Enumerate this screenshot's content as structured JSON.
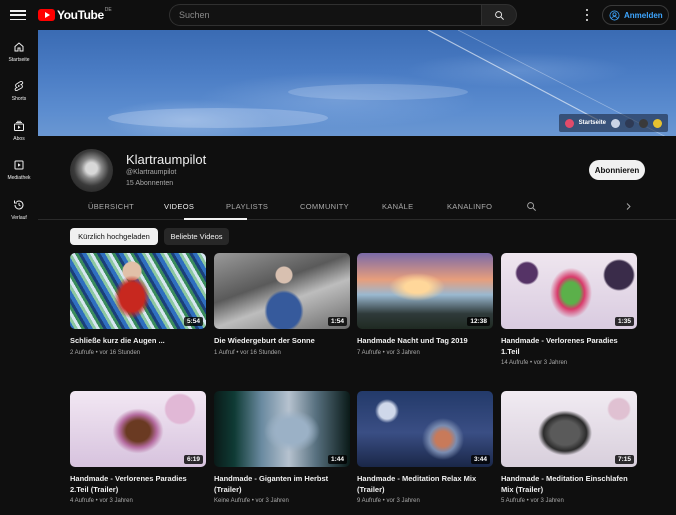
{
  "header": {
    "logo_text": "YouTube",
    "logo_country": "DE",
    "search_placeholder": "Suchen",
    "signin_label": "Anmelden"
  },
  "leftnav": {
    "items": [
      {
        "label": "Startseite",
        "icon": "home-icon"
      },
      {
        "label": "Shorts",
        "icon": "shorts-icon"
      },
      {
        "label": "Abos",
        "icon": "subscriptions-icon"
      },
      {
        "label": "Mediathek",
        "icon": "library-icon"
      },
      {
        "label": "Verlauf",
        "icon": "history-icon"
      }
    ]
  },
  "banner": {
    "link_label": "Startseite"
  },
  "channel": {
    "name": "Klartraumpilot",
    "handle": "@Klartraumpilot",
    "subscribers": "15 Abonnenten",
    "subscribe_label": "Abonnieren"
  },
  "tabs": [
    "ÜBERSICHT",
    "VIDEOS",
    "PLAYLISTS",
    "COMMUNITY",
    "KANÄLE",
    "KANALINFO"
  ],
  "active_tab": "VIDEOS",
  "chips": [
    "Kürzlich hochgeladen",
    "Beliebte Videos"
  ],
  "videos": [
    {
      "title": "Schließe kurz die Augen ...",
      "meta": "2 Aufrufe • vor 16 Stunden",
      "duration": "5:54"
    },
    {
      "title": "Die Wiedergeburt der Sonne",
      "meta": "1 Aufruf • vor 16 Stunden",
      "duration": "1:54"
    },
    {
      "title": "Handmade Nacht und Tag 2019",
      "meta": "7 Aufrufe • vor 3 Jahren",
      "duration": "12:38"
    },
    {
      "title": "Handmade - Verlorenes Paradies 1.Teil",
      "meta": "14 Aufrufe • vor 3 Jahren",
      "duration": "1:35"
    },
    {
      "title": "Handmade - Verlorenes Paradies 2.Teil (Trailer)",
      "meta": "4 Aufrufe • vor 3 Jahren",
      "duration": "6:19"
    },
    {
      "title": "Handmade - Giganten im Herbst (Trailer)",
      "meta": "Keine Aufrufe • vor 3 Jahren",
      "duration": "1:44"
    },
    {
      "title": "Handmade - Meditation Relax Mix (Trailer)",
      "meta": "9 Aufrufe • vor 3 Jahren",
      "duration": "3:44"
    },
    {
      "title": "Handmade - Meditation Einschlafen Mix (Trailer)",
      "meta": "5 Aufrufe • vor 3 Jahren",
      "duration": "7:15"
    }
  ],
  "colors": {
    "background": "#0f0f0f",
    "accent_red": "#ff0000",
    "link_blue": "#3ea6ff"
  }
}
